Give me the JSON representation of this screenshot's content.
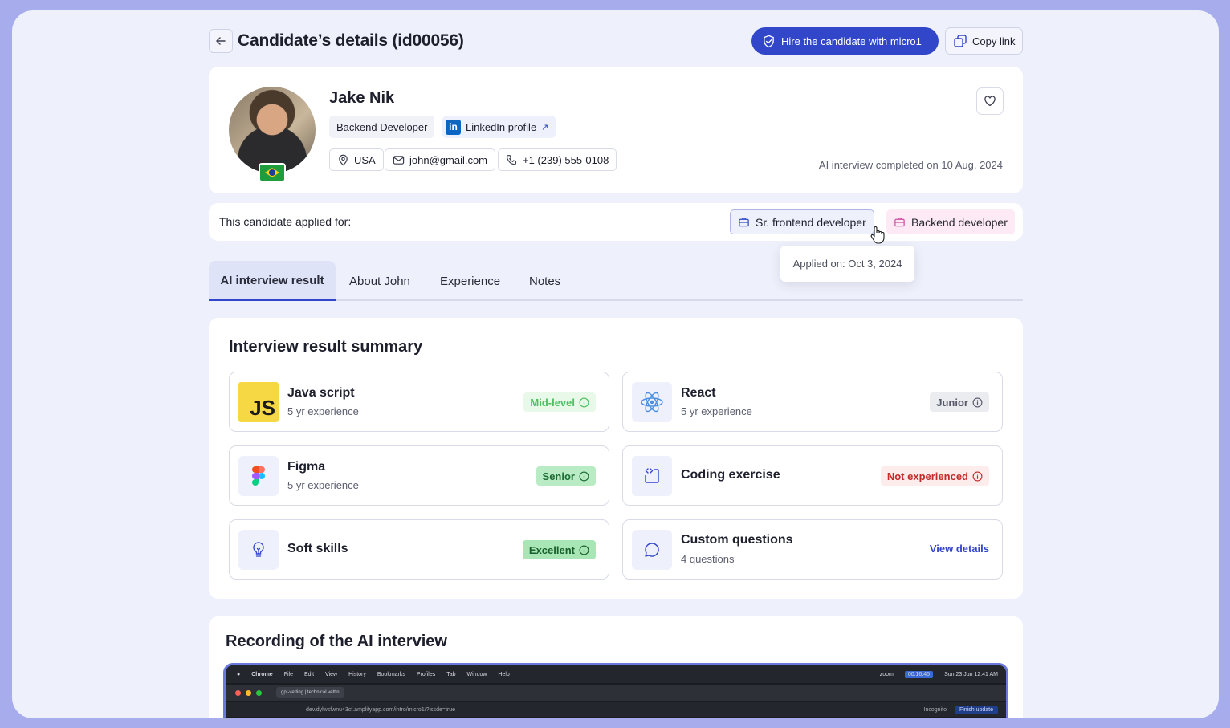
{
  "header": {
    "title": "Candidate’s details (id00056)",
    "hire_label": "Hire the candidate with micro1",
    "copy_label": "Copy link"
  },
  "profile": {
    "name": "Jake Nik",
    "role": "Backend Developer",
    "linkedin_label": "LinkedIn profile",
    "linkedin_arrow": "↗",
    "country": "USA",
    "email": "john@gmail.com",
    "phone": "+1 (239) 555-0108",
    "completed_text": "AI interview completed on 10 Aug, 2024"
  },
  "applied": {
    "label": "This candidate applied for:",
    "jobs": [
      {
        "title": "Sr. frontend developer"
      },
      {
        "title": "Backend developer"
      }
    ],
    "tooltip": "Applied on: Oct 3, 2024"
  },
  "tabs": [
    {
      "label": "AI interview result"
    },
    {
      "label": "About John"
    },
    {
      "label": "Experience"
    },
    {
      "label": "Notes"
    }
  ],
  "summary": {
    "title": "Interview result summary",
    "skills": [
      {
        "name": "Java script",
        "sub": "5 yr experience",
        "badge": "Mid-level",
        "icon": "javascript-icon"
      },
      {
        "name": "React",
        "sub": "5 yr experience",
        "badge": "Junior",
        "icon": "react-icon"
      },
      {
        "name": "Figma",
        "sub": "5 yr experience",
        "badge": "Senior",
        "icon": "figma-icon"
      },
      {
        "name": "Coding exercise",
        "badge": "Not experienced",
        "icon": "code-icon"
      },
      {
        "name": "Soft skills",
        "badge": "Excellent",
        "icon": "lightbulb-icon"
      },
      {
        "name": "Custom questions",
        "sub": "4 questions",
        "link": "View details",
        "icon": "chat-bubble-icon"
      }
    ],
    "js_logo_text": "JS"
  },
  "recording": {
    "title": "Recording of the AI interview",
    "menu": [
      "Chrome",
      "File",
      "Edit",
      "View",
      "History",
      "Bookmarks",
      "Profiles",
      "Tab",
      "Window",
      "Help"
    ],
    "menu_right": [
      "zoom",
      "00:16:45",
      "Sun 23 Jun  12:41 AM"
    ],
    "tab_label": "gpt-vetting | technical vettin",
    "url": "dev.dylwsfwnu43cf.amplifyapp.com/intro/micro1/?issde=true",
    "incognito": "Incognito",
    "finish_update": "Finish update"
  }
}
